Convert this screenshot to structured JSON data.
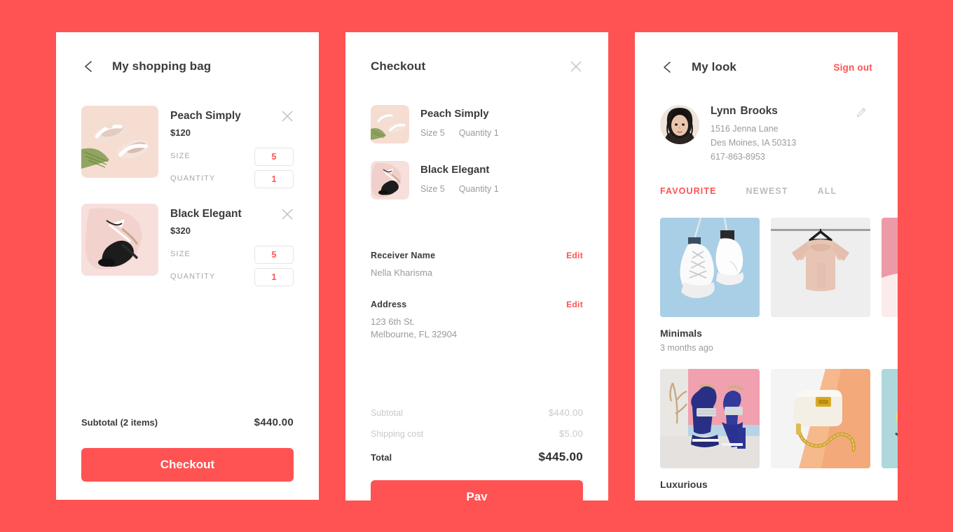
{
  "theme": {
    "accent": "#ff5252",
    "background": "#ff5252",
    "panel": "#ffffff",
    "text_dark": "#3b3b3b",
    "text_muted": "#9b9b9b",
    "text_faint": "#c9c9c9"
  },
  "bag": {
    "title": "My shopping bag",
    "back_icon": "chevron-left-icon",
    "items": [
      {
        "name": "Peach Simply",
        "price": "$120",
        "size_label": "SIZE",
        "size_value": "5",
        "qty_label": "QUANTITY",
        "qty_value": "1",
        "remove_icon": "close-icon",
        "image": "peach-sandals-thumbnail"
      },
      {
        "name": "Black Elegant",
        "price": "$320",
        "size_label": "SIZE",
        "size_value": "5",
        "qty_label": "QUANTITY",
        "qty_value": "1",
        "remove_icon": "close-icon",
        "image": "black-heel-thumbnail"
      }
    ],
    "subtotal_label": "Subtotal (2 items)",
    "subtotal_value": "$440.00",
    "checkout_button": "Checkout"
  },
  "checkout": {
    "title": "Checkout",
    "close_icon": "close-icon",
    "items": [
      {
        "name": "Peach Simply",
        "size": "Size 5",
        "quantity": "Quantity 1",
        "image": "peach-sandals-thumbnail"
      },
      {
        "name": "Black Elegant",
        "size": "Size 5",
        "quantity": "Quantity 1",
        "image": "black-heel-thumbnail"
      }
    ],
    "receiver": {
      "label": "Receiver Name",
      "edit": "Edit",
      "value": "Nella Kharisma"
    },
    "address": {
      "label": "Address",
      "edit": "Edit",
      "line1": "123 6th St.",
      "line2": "Melbourne, FL 32904"
    },
    "totals": [
      {
        "label": "Subtotal",
        "value": "$440.00",
        "muted": true
      },
      {
        "label": "Shipping cost",
        "value": "$5.00",
        "muted": true
      },
      {
        "label": "Total",
        "value": "$445.00",
        "muted": false
      }
    ],
    "pay_button": "Pay"
  },
  "look": {
    "title": "My look",
    "back_icon": "chevron-left-icon",
    "sign_out": "Sign out",
    "profile": {
      "avatar": "user-avatar",
      "first_name": "Lynn",
      "last_name": "Brooks",
      "address_line1": "1516 Jenna Lane",
      "address_line2": "Des Moines, IA 50313",
      "phone": "617-863-8953",
      "edit_icon": "pencil-icon"
    },
    "tabs": [
      {
        "label": "FAVOURITE",
        "active": true
      },
      {
        "label": "NEWEST",
        "active": false
      },
      {
        "label": "ALL",
        "active": false
      }
    ],
    "collections": [
      {
        "title": "Minimals",
        "date": "3 months ago",
        "images": [
          "white-boots-blue-bg",
          "pink-sweater-hanger",
          "pink-abstract-partial"
        ]
      },
      {
        "title": "Luxurious",
        "date": "",
        "images": [
          "blue-heels-pink-bg",
          "cream-chain-bag",
          "teal-floral-partial"
        ]
      }
    ]
  }
}
